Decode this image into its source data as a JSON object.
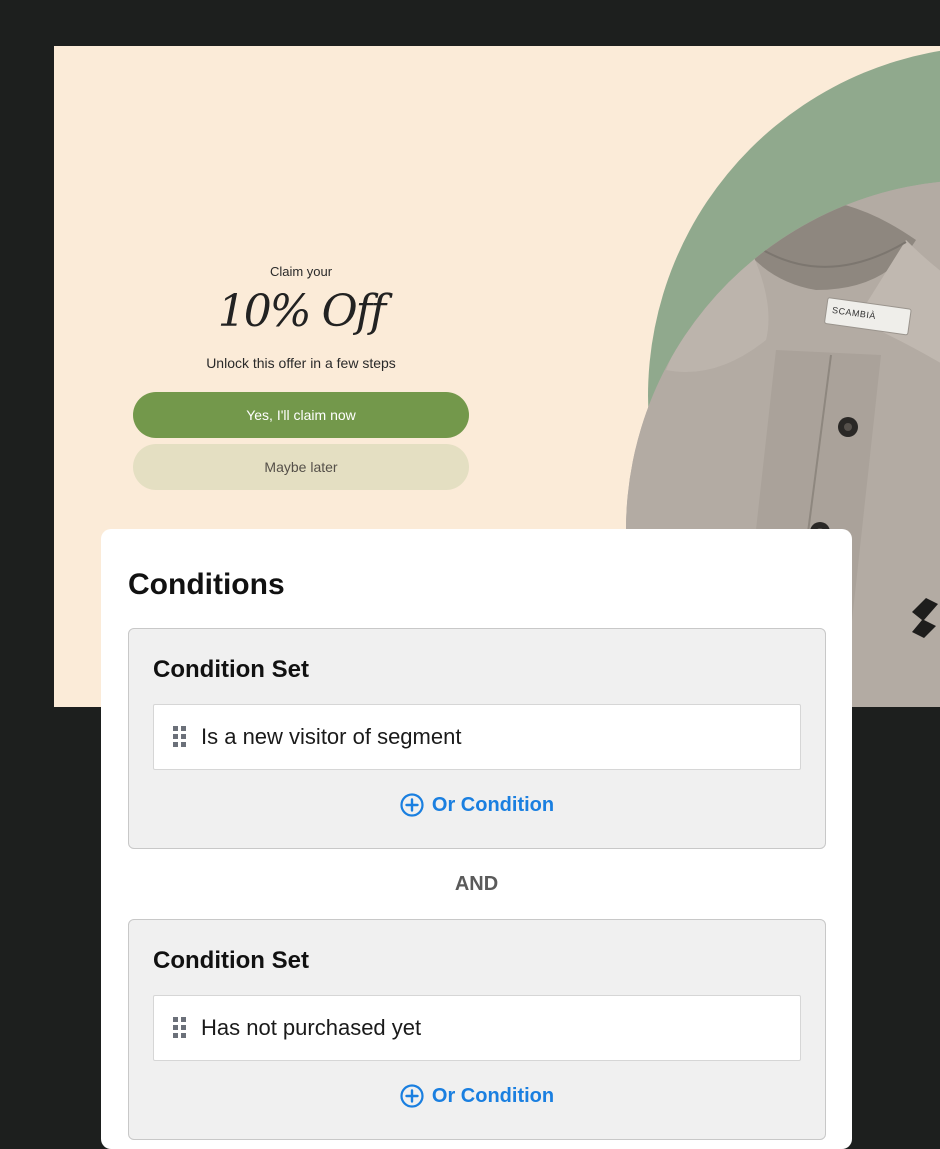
{
  "popup": {
    "eyebrow": "Claim your",
    "headline": "10% Off",
    "subline": "Unlock this offer in a few steps",
    "primary_button": "Yes, I'll claim now",
    "secondary_button": "Maybe later",
    "brand_label": "SCAMBIÀ",
    "colors": {
      "background": "#fbebd8",
      "accent_circle": "#90a98d",
      "primary_button": "#73984b",
      "secondary_button": "#e4dfc2"
    }
  },
  "conditions": {
    "title": "Conditions",
    "connector": "AND",
    "sets": [
      {
        "title": "Condition Set",
        "condition": "Is a new visitor of segment",
        "add_label": "Or Condition"
      },
      {
        "title": "Condition Set",
        "condition": "Has not purchased yet",
        "add_label": "Or Condition"
      }
    ],
    "icons": {
      "handle": "drag-handle-icon",
      "add": "plus-circle-icon"
    },
    "colors": {
      "link": "#1a7fe0"
    }
  }
}
